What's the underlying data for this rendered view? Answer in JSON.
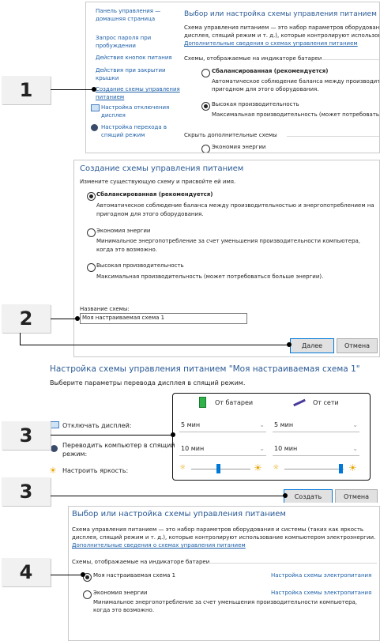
{
  "steps": {
    "s1": "1",
    "s2": "2",
    "s3a": "3",
    "s3b": "3",
    "s4": "4"
  },
  "panel1": {
    "sidebar": [
      {
        "l1": "Панель управления —",
        "l2": "домашняя страница"
      },
      {
        "l1": "Запрос пароля при",
        "l2": "пробуждении"
      },
      {
        "l1": "Действия кнопок питания",
        "l2": ""
      },
      {
        "l1": "Действия при закрытии",
        "l2": "крышки"
      },
      {
        "l1": "Создание схемы управления",
        "l2": "питанием"
      },
      {
        "l1": "Настройка отключения",
        "l2": "дисплея"
      },
      {
        "l1": "Настройка перехода в",
        "l2": "спящий режим"
      }
    ],
    "title": "Выбор или настройка схемы управления питанием",
    "desc1": "Схема управления питанием — это набор параметров оборудования",
    "desc2": "дисплея, спящий режим и т. д.), которые контролируют использова",
    "more_link": "Дополнительные сведения о схемах управления питанием",
    "group": "Схемы, отображаемые на индикаторе батареи",
    "plan_balanced": "Сбалансированная (рекомендуется)",
    "plan_balanced_d1": "Автоматическое соблюдение баланса между производитель",
    "plan_balanced_d2": "пригодном для этого оборудования.",
    "plan_high": "Высокая производительность",
    "plan_high_d": "Максимальная производительность (может потребоваться бо",
    "hide": "Скрыть дополнительные схемы",
    "plan_saver": "Экономия энергии"
  },
  "panel2": {
    "title": "Создание схемы управления питанием",
    "subtitle": "Измените существующую схему и присвойте ей имя.",
    "o1": "Сбалансированная (рекомендуется)",
    "o1_d1": "Автоматическое соблюдение баланса между производительностью и энергопотреблением на",
    "o1_d2": "пригодном для этого оборудования.",
    "o2": "Экономия энергии",
    "o2_d1": "Минимальное энергопотребление за счет уменьшения производительности компьютера,",
    "o2_d2": "когда это возможно.",
    "o3": "Высокая производительность",
    "o3_d": "Максимальная производительность (может потребоваться больше энергии).",
    "name_label": "Название схемы:",
    "name_value": "Моя настраиваемая схема 1",
    "next": "Далее",
    "cancel": "Отмена"
  },
  "panel3": {
    "title": "Настройка схемы управления питанием \"Моя настраиваемая схема 1\"",
    "subtitle": "Выберите параметры перевода дисплея в спящий режим.",
    "col_battery": "От батареи",
    "col_ac": "От сети",
    "row1": "Отключать дисплей:",
    "row2_l1": "Переводить компьютер в спящий",
    "row2_l2": "режим:",
    "row3": "Настроить яркость:",
    "v1": "5 мин",
    "v2": "5 мин",
    "v3": "10 мин",
    "v4": "10 мин",
    "brightness_battery": 0.45,
    "brightness_ac": 0.95,
    "create": "Создать",
    "cancel": "Отмена"
  },
  "panel4": {
    "title": "Выбор или настройка схемы управления питанием",
    "d1": "Схема управления питанием — это набор параметров оборудования и системы (таких как яркость",
    "d2": "дисплея, спящий режим и т. д.), которые контролируют использование компьютером электроэнергии.",
    "more_link": "Дополнительные сведения о схемах управления питанием",
    "group": "Схемы, отображаемые на индикаторе батареи",
    "p1": "Моя настраиваемая схема 1",
    "p1_link": "Настройка схемы электропитания",
    "p2": "Экономия энергии",
    "p2_link": "Настройка схемы электропитания",
    "p2_d1": "Минимальное энергопотребление за счет уменьшения производительности компьютера,",
    "p2_d2": "когда это возможно."
  },
  "colors": {
    "accent": "#0078d7",
    "link": "#1b5ea8",
    "title": "#2a5a96"
  }
}
